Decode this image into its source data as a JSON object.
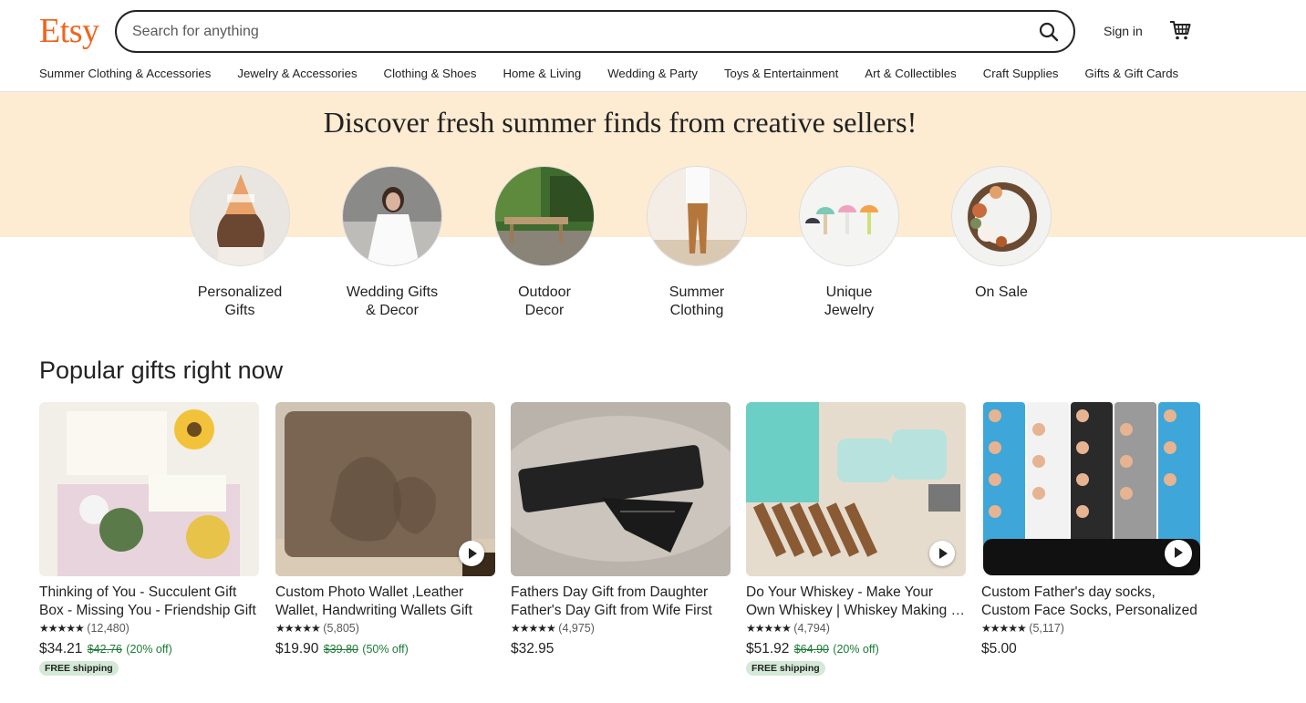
{
  "header": {
    "logo": "Etsy",
    "search_placeholder": "Search for anything",
    "signin": "Sign in",
    "search_icon": "search-icon",
    "cart_icon": "cart-icon"
  },
  "nav": [
    "Summer Clothing & Accessories",
    "Jewelry & Accessories",
    "Clothing & Shoes",
    "Home & Living",
    "Wedding & Party",
    "Toys & Entertainment",
    "Art & Collectibles",
    "Craft Supplies",
    "Gifts & Gift Cards"
  ],
  "hero": {
    "title": "Discover fresh summer finds from creative sellers!",
    "categories": [
      {
        "line1": "Personalized",
        "line2": "Gifts"
      },
      {
        "line1": "Wedding Gifts",
        "line2": "& Decor"
      },
      {
        "line1": "Outdoor",
        "line2": "Decor"
      },
      {
        "line1": "Summer",
        "line2": "Clothing"
      },
      {
        "line1": "Unique",
        "line2": "Jewelry"
      },
      {
        "line1": "On Sale",
        "line2": ""
      }
    ]
  },
  "popular": {
    "title": "Popular gifts right now",
    "items": [
      {
        "title1": "Thinking of You - Succulent Gift",
        "title2": "Box - Missing You - Friendship Gift",
        "stars": "★★★★★",
        "reviews": "(12,480)",
        "price": "$34.21",
        "original": "$42.76",
        "discount": "(20% off)",
        "badge": "FREE shipping"
      },
      {
        "title1": "Custom Photo Wallet ,Leather",
        "title2": "Wallet, Handwriting Wallets Gift",
        "stars": "★★★★★",
        "reviews": "(5,805)",
        "price": "$19.90",
        "original": "$39.80",
        "discount": "(50% off)",
        "badge": ""
      },
      {
        "title1": "Fathers Day Gift from Daughter",
        "title2": "Father's Day Gift from Wife First",
        "stars": "★★★★★",
        "reviews": "(4,975)",
        "price": "$32.95",
        "original": "",
        "discount": "",
        "badge": ""
      },
      {
        "title1": "Do Your Whiskey - Make Your",
        "title2": "Own Whiskey | Whiskey Making Kit",
        "stars": "★★★★★",
        "reviews": "(4,794)",
        "price": "$51.92",
        "original": "$64.90",
        "discount": "(20% off)",
        "badge": "FREE shipping"
      },
      {
        "title1": "Custom Father's day socks,",
        "title2": "Custom Face Socks, Personalized",
        "stars": "★★★★★",
        "reviews": "(5,117)",
        "price": "$5.00",
        "original": "",
        "discount": "",
        "badge": ""
      }
    ]
  }
}
